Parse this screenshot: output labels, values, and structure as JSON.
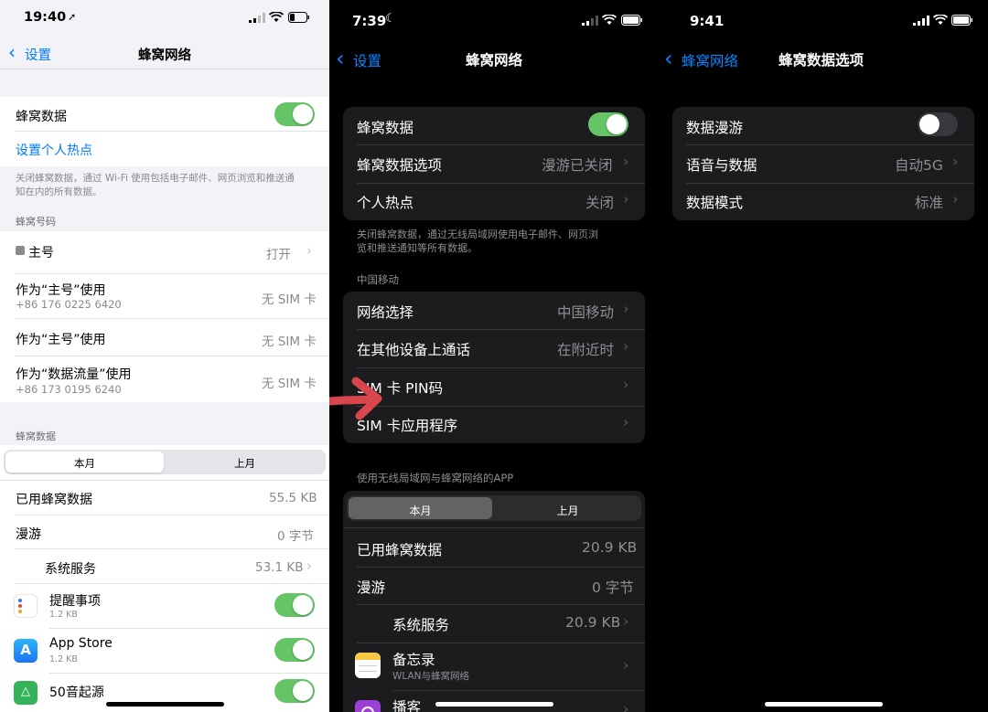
{
  "colors": {
    "ios_green": "#65c466",
    "ios_blue": "#007aff",
    "dark_cell": "#1c1c1e",
    "arrow_red": "#d9454d"
  },
  "panel1": {
    "status_time": "19:40",
    "back_label": "设置",
    "title": "蜂窝网络",
    "cellular_data_label": "蜂窝数据",
    "hotspot_link": "设置个人热点",
    "footer_note_1": "关闭蜂窝数据，通过 Wi-Fi 使用包括电子邮件、网页浏览和推送通",
    "footer_note_2": "知在内的所有数据。",
    "numbers_header": "蜂窝号码",
    "primary_label": "主号",
    "primary_value": "打开",
    "use_as_primary_1": "作为“主号”使用",
    "use_as_primary_1_sub": "+86 176 0225 6420",
    "use_as_primary_1_value": "无 SIM 卡",
    "use_as_primary_2": "作为“主号”使用",
    "use_as_primary_2_value": "无 SIM 卡",
    "use_as_data": "作为“数据流量”使用",
    "use_as_data_sub": "+86 173 0195 6240",
    "use_as_data_value": "无 SIM 卡",
    "data_header": "蜂窝数据",
    "seg_current": "本月",
    "seg_last": "上月",
    "used_label": "已用蜂窝数据",
    "used_value": "55.5 KB",
    "roaming_label": "漫游",
    "roaming_value": "0 字节",
    "system_label": "系统服务",
    "system_value": "53.1 KB",
    "apps": [
      {
        "name": "提醒事项",
        "size": "1.2 KB"
      },
      {
        "name": "App Store",
        "size": "1.2 KB"
      },
      {
        "name": "50音起源",
        "size": ""
      }
    ]
  },
  "panel2": {
    "status_time": "7:39",
    "back_label": "设置",
    "title": "蜂窝网络",
    "cellular_data_label": "蜂窝数据",
    "options_label": "蜂窝数据选项",
    "options_value": "漫游已关闭",
    "hotspot_label": "个人热点",
    "hotspot_value": "关闭",
    "footer_note_1": "关闭蜂窝数据，通过无线局域网使用电子邮件、网页浏",
    "footer_note_2": "览和推送通知等所有数据。",
    "carrier_header": "中国移动",
    "network_select_label": "网络选择",
    "network_select_value": "中国移动",
    "calls_other_label": "在其他设备上通话",
    "calls_other_value": "在附近时",
    "sim_pin_label": "SIM 卡 PIN码",
    "sim_apps_label": "SIM 卡应用程序",
    "apps_header": "使用无线局域网与蜂窝网络的APP",
    "seg_current": "本月",
    "seg_last": "上月",
    "used_label": "已用蜂窝数据",
    "used_value": "20.9 KB",
    "roaming_label": "漫游",
    "roaming_value": "0 字节",
    "system_label": "系统服务",
    "system_value": "20.9 KB",
    "notes_name": "备忘录",
    "notes_sub": "WLAN与蜂窝网络",
    "podcast_name": "播客"
  },
  "panel3": {
    "status_time": "9:41",
    "back_label": "蜂窝网络",
    "title": "蜂窝数据选项",
    "roaming_label": "数据漫游",
    "voice_label": "语音与数据",
    "voice_value": "自动5G",
    "mode_label": "数据模式",
    "mode_value": "标准"
  }
}
